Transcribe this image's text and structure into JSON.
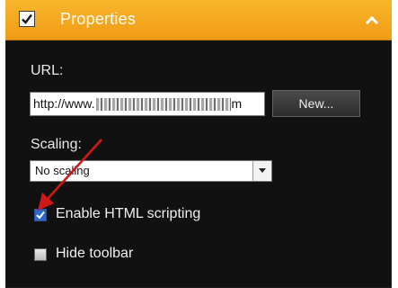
{
  "header": {
    "title": "Properties",
    "enabled": true,
    "accent_color": "#f4a11e",
    "collapse_icon": "chevron-up-icon"
  },
  "url": {
    "label": "URL:",
    "value_prefix": "http://www.",
    "value_suffix": "m",
    "new_button_label": "New..."
  },
  "scaling": {
    "label": "Scaling:",
    "selected": "No scaling"
  },
  "options": {
    "enable_html_scripting": {
      "label": "Enable HTML scripting",
      "checked": true
    },
    "hide_toolbar": {
      "label": "Hide toolbar",
      "checked": false
    }
  },
  "annotation": {
    "type": "red-arrow-icon",
    "color": "#d01818",
    "target": "enable-html-scripting-checkbox"
  }
}
